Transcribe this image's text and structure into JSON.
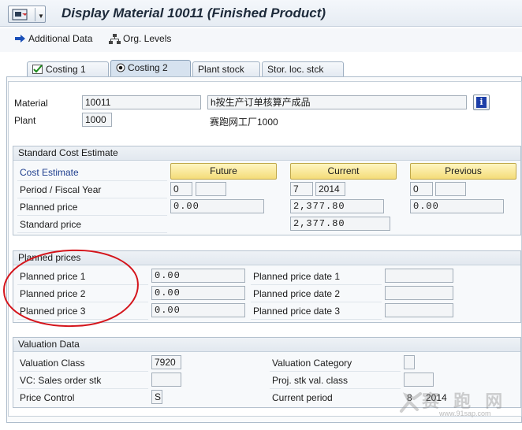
{
  "window": {
    "title": "Display Material 10011 (Finished Product)"
  },
  "toolbar": {
    "additional_data": "Additional Data",
    "org_levels": "Org. Levels"
  },
  "tabs": [
    {
      "label": "Costing 1"
    },
    {
      "label": "Costing 2"
    },
    {
      "label": "Plant stock"
    },
    {
      "label": "Stor. loc. stck"
    }
  ],
  "header": {
    "material_label": "Material",
    "material_value": "10011",
    "material_desc": "h按生产订单核算产成品",
    "plant_label": "Plant",
    "plant_value": "1000",
    "plant_desc": "赛跑网工厂1000"
  },
  "std_cost": {
    "title": "Standard Cost Estimate",
    "cost_estimate_label": "Cost Estimate",
    "future_btn": "Future",
    "current_btn": "Current",
    "previous_btn": "Previous",
    "period_label": "Period / Fiscal Year",
    "future_period": "0",
    "future_year": "",
    "current_period": "7",
    "current_year": "2014",
    "previous_period": "0",
    "previous_year": "",
    "planned_price_label": "Planned price",
    "future_planned": "0.00",
    "current_planned": "2,377.80",
    "previous_planned": "0.00",
    "standard_price_label": "Standard price",
    "current_standard": "2,377.80"
  },
  "planned_prices": {
    "title": "Planned prices",
    "price1_label": "Planned price 1",
    "price1_value": "0.00",
    "price2_label": "Planned price 2",
    "price2_value": "0.00",
    "price3_label": "Planned price 3",
    "price3_value": "0.00",
    "date1_label": "Planned price date 1",
    "date1_value": "",
    "date2_label": "Planned price date 2",
    "date2_value": "",
    "date3_label": "Planned price date 3",
    "date3_value": ""
  },
  "valuation": {
    "title": "Valuation Data",
    "val_class_label": "Valuation Class",
    "val_class_value": "7920",
    "vc_sales_label": "VC: Sales order stk",
    "vc_sales_value": "",
    "price_control_label": "Price Control",
    "price_control_value": "S",
    "val_category_label": "Valuation Category",
    "val_category_value": "",
    "proj_stk_label": "Proj. stk val. class",
    "proj_stk_value": "",
    "current_period_label": "Current period",
    "current_period_value": "8",
    "current_period_year": "2014"
  },
  "watermark": {
    "text": "赛 跑 网",
    "url": "www.91sap.com"
  },
  "colors": {
    "highlight_button": "#f4dc78",
    "annotation_circle": "#d4141b",
    "link_blue": "#1f3f8f"
  }
}
